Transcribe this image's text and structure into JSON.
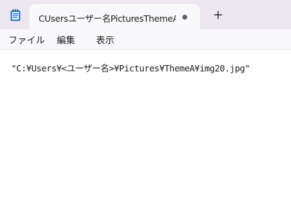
{
  "window": {
    "tab_title": "CUsersユーザー名PicturesThemeAimg",
    "new_tab_label": "+"
  },
  "menu": {
    "file": "ファイル",
    "edit": "編集",
    "view": "表示"
  },
  "editor": {
    "content": "\"C:¥Users¥<ユーザー名>¥Pictures¥ThemeA¥img20.jpg\""
  },
  "icons": {
    "app": "notepad-icon",
    "unsaved": "unsaved-dot-icon",
    "new_tab": "plus-icon"
  },
  "colors": {
    "titlebar": "#ede7f0",
    "tab": "#f9f9fb",
    "accent": "#3a7bd5"
  }
}
